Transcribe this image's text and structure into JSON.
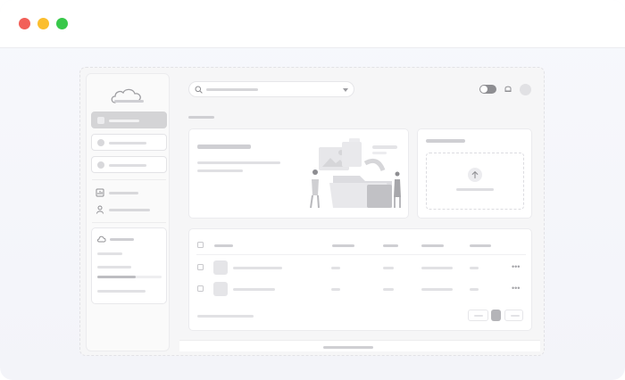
{
  "window": {
    "controls": [
      {
        "name": "close",
        "color": "#f25f58"
      },
      {
        "name": "minimize",
        "color": "#fbbe2e"
      },
      {
        "name": "maximize",
        "color": "#38c84a"
      }
    ]
  },
  "sidebar": {
    "logo_icon": "cloud-icon",
    "items": [
      {
        "state": "active",
        "icon": "placeholder-square"
      },
      {
        "state": "default",
        "icon": "placeholder-circle"
      },
      {
        "state": "default",
        "icon": "placeholder-circle"
      }
    ],
    "secondary_items": [
      {
        "icon": "chart-icon"
      },
      {
        "icon": "user-icon"
      }
    ],
    "storage": {
      "icon": "cloud-icon",
      "usage_fraction": 0.6
    }
  },
  "header": {
    "search_icon": "search-icon",
    "dropdown_icon": "caret-down-icon",
    "toggle_state": "on",
    "notification_icon": "bell-icon"
  },
  "hero_card": {
    "illustration": "people-organizing-files-illustration"
  },
  "upload_card": {
    "icon": "upload-arrow-icon"
  },
  "table": {
    "row_count": 2,
    "row_menu_icon": "more-horizontal-icon"
  },
  "pagination": {
    "current_page_highlighted": true
  }
}
